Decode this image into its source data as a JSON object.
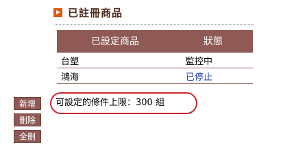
{
  "section": {
    "title": "已註冊商品"
  },
  "table": {
    "headers": {
      "product": "已設定商品",
      "status": "狀態"
    },
    "rows": [
      {
        "product": "台塑",
        "status": "監控中"
      },
      {
        "product": "鴻海",
        "status": "已停止"
      }
    ]
  },
  "buttons": {
    "add": "新增",
    "delete": "刪除",
    "delete_all": "全刪"
  },
  "limit_note": "可設定的條件上限：300 組",
  "colors": {
    "accent_icon": "#e05a14",
    "table_header": "#8f5a55",
    "stopped_status": "#1d3fa8",
    "highlight_circle": "#d4262a"
  }
}
